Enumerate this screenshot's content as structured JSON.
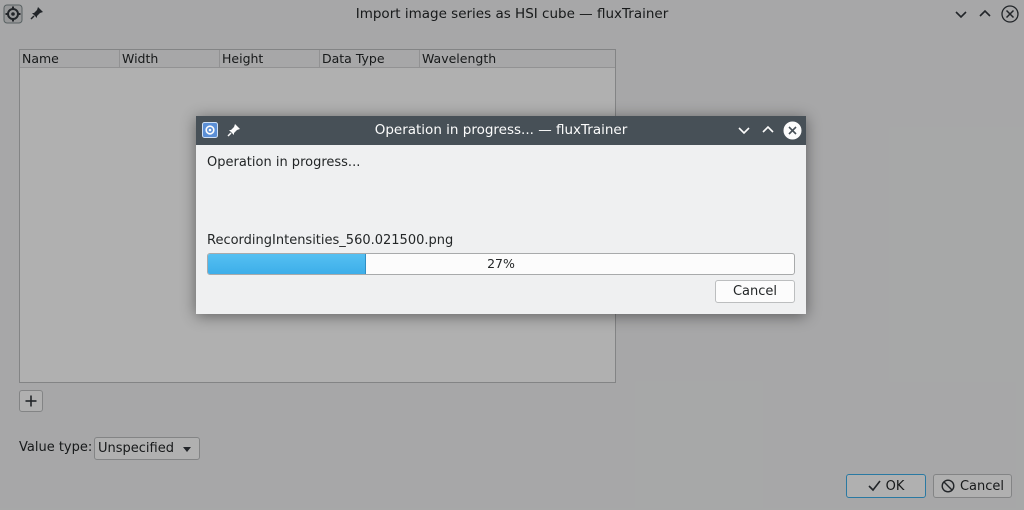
{
  "main_window": {
    "title": "Import image series as HSI cube — fluxTrainer",
    "icons": {
      "app": "gear-icon",
      "pin": "pin-icon",
      "minimize": "chevron-down-icon",
      "maximize": "chevron-up-icon",
      "close": "close-icon"
    },
    "table": {
      "columns": [
        "Name",
        "Width",
        "Height",
        "Data Type",
        "Wavelength"
      ],
      "rows": []
    },
    "add_button_label": "+",
    "value_type": {
      "label": "Value type:",
      "selected": "Unspecified"
    },
    "ok_label": "OK",
    "cancel_label": "Cancel"
  },
  "progress_dialog": {
    "title": "Operation in progress... — fluxTrainer",
    "message": "Operation in progress...",
    "current_file": "RecordingIntensities_560.021500.png",
    "progress": {
      "percent": 27,
      "text": "27%"
    },
    "cancel_label": "Cancel"
  },
  "colors": {
    "accent": "#3daee9",
    "dialog_titlebar": "#475057",
    "window_bg": "#eff0f1"
  }
}
